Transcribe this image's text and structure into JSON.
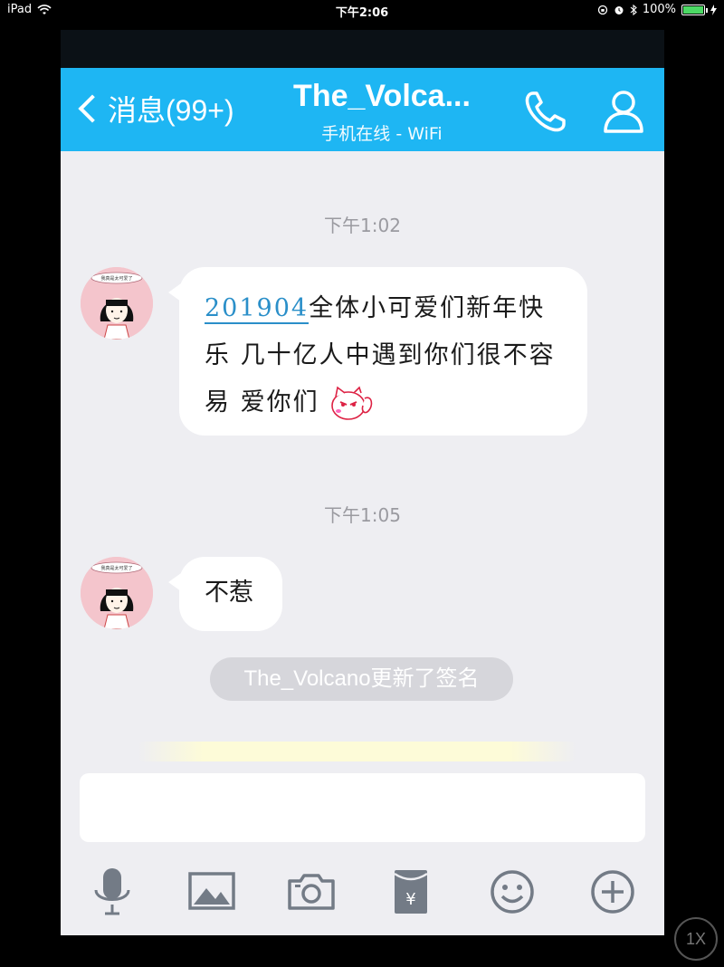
{
  "status_bar": {
    "device": "iPad",
    "time": "下午2:06",
    "battery": "100%",
    "battery_level": 1.0
  },
  "nav": {
    "back_label": "消息(99+)",
    "title": "The_Volca...",
    "subtitle": "手机在线 - WiFi",
    "icons": [
      "phone-icon",
      "profile-icon"
    ]
  },
  "chat": {
    "messages": [
      {
        "time": "下午1:02",
        "text_highlight": "201904",
        "text": "全体小可爱们新年快乐 几十亿人中遇到你们很不容易 爱你们",
        "avatar_caption": "我真是太可爱了"
      },
      {
        "time": "下午1:05",
        "text": "不惹",
        "avatar_caption": "我真是太可爱了"
      }
    ],
    "system_note": "The_Volcano更新了签名"
  },
  "toolbar": {
    "icons": [
      "microphone-icon",
      "image-icon",
      "camera-icon",
      "red-packet-icon",
      "emoji-icon",
      "plus-icon"
    ],
    "red_packet_symbol": "¥"
  },
  "zoom_badge": "1X",
  "colors": {
    "nav_bg": "#1eb6f3",
    "chat_bg": "#eeeef2",
    "link": "#2a8fc9",
    "system_note_bg": "#d6d6db"
  }
}
